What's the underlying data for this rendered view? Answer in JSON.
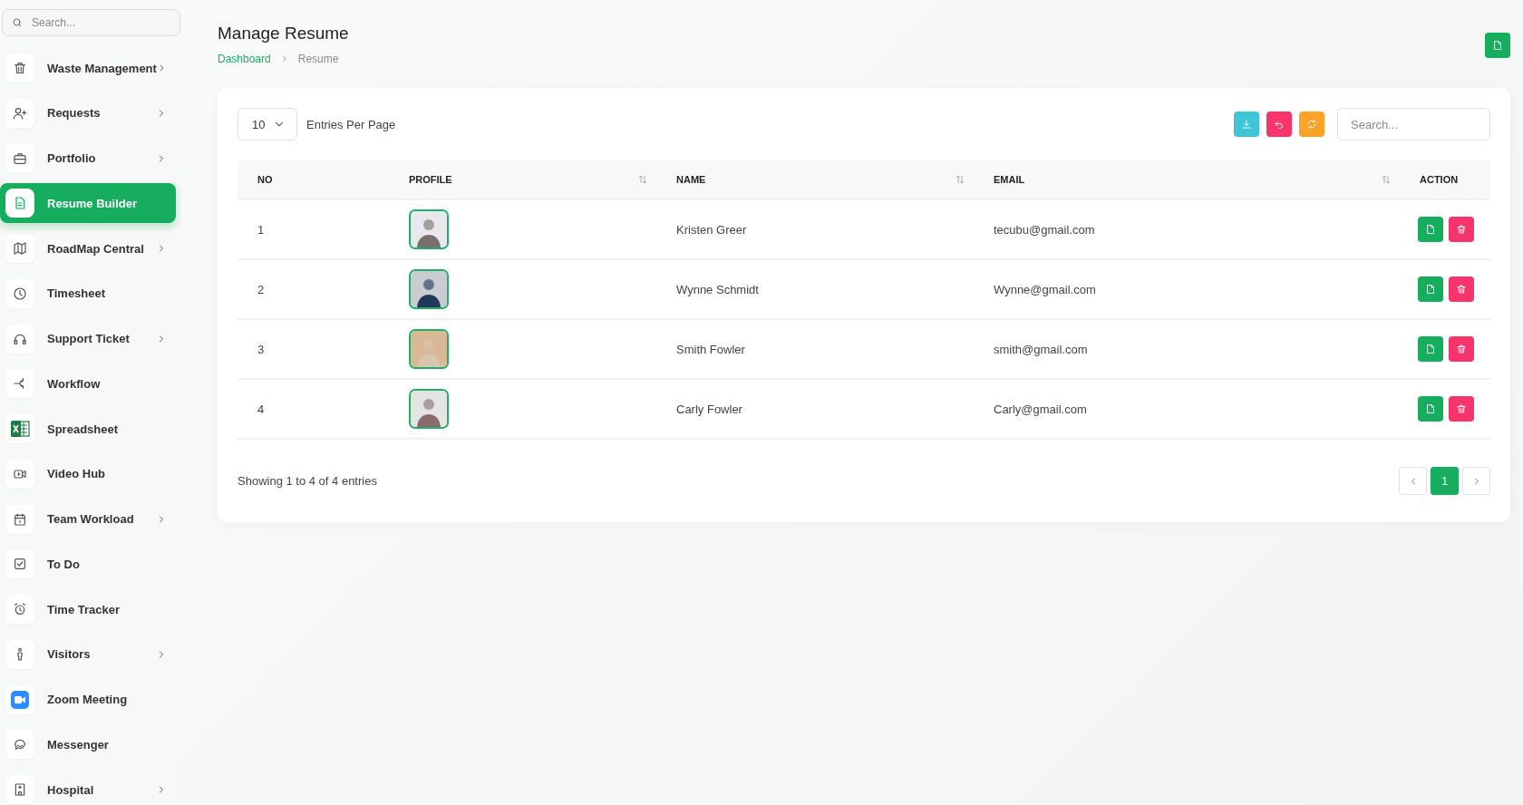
{
  "sidebar": {
    "search": {
      "placeholder": "Search..."
    },
    "items": [
      {
        "label": "Waste Management",
        "has_submenu": true,
        "selected": false
      },
      {
        "label": "Requests",
        "has_submenu": true,
        "selected": false
      },
      {
        "label": "Portfolio",
        "has_submenu": true,
        "selected": false
      },
      {
        "label": "Resume Builder",
        "has_submenu": false,
        "selected": true
      },
      {
        "label": "RoadMap Central",
        "has_submenu": true,
        "selected": false
      },
      {
        "label": "Timesheet",
        "has_submenu": false,
        "selected": false
      },
      {
        "label": "Support Ticket",
        "has_submenu": true,
        "selected": false
      },
      {
        "label": "Workflow",
        "has_submenu": false,
        "selected": false
      },
      {
        "label": "Spreadsheet",
        "has_submenu": false,
        "selected": false
      },
      {
        "label": "Video Hub",
        "has_submenu": false,
        "selected": false
      },
      {
        "label": "Team Workload",
        "has_submenu": true,
        "selected": false
      },
      {
        "label": "To Do",
        "has_submenu": false,
        "selected": false
      },
      {
        "label": "Time Tracker",
        "has_submenu": false,
        "selected": false
      },
      {
        "label": "Visitors",
        "has_submenu": true,
        "selected": false
      },
      {
        "label": "Zoom Meeting",
        "has_submenu": false,
        "selected": false
      },
      {
        "label": "Messenger",
        "has_submenu": false,
        "selected": false
      },
      {
        "label": "Hospital",
        "has_submenu": true,
        "selected": false
      }
    ]
  },
  "header": {
    "title": "Manage Resume",
    "breadcrumb": [
      {
        "label": "Dashboard",
        "link": true
      },
      {
        "label": "Resume",
        "link": false
      }
    ]
  },
  "toolbar": {
    "page_size": "10",
    "page_size_label": "Entries Per Page",
    "search": {
      "placeholder": "Search..."
    }
  },
  "table": {
    "columns": [
      {
        "label": "NO",
        "sortable": false
      },
      {
        "label": "PROFILE",
        "sortable": true
      },
      {
        "label": "NAME",
        "sortable": true
      },
      {
        "label": "EMAIL",
        "sortable": true
      },
      {
        "label": "ACTION",
        "sortable": false
      }
    ],
    "rows": [
      {
        "no": "1",
        "name": "Kristen Greer",
        "email": "tecubu@gmail.com"
      },
      {
        "no": "2",
        "name": "Wynne Schmidt",
        "email": "Wynne@gmail.com"
      },
      {
        "no": "3",
        "name": "Smith Fowler",
        "email": "smith@gmail.com"
      },
      {
        "no": "4",
        "name": "Carly Fowler",
        "email": "Carly@gmail.com"
      }
    ]
  },
  "footer": {
    "summary": "Showing 1 to 4 of 4 entries",
    "pages": [
      {
        "label": "1",
        "selected": true
      }
    ]
  }
}
